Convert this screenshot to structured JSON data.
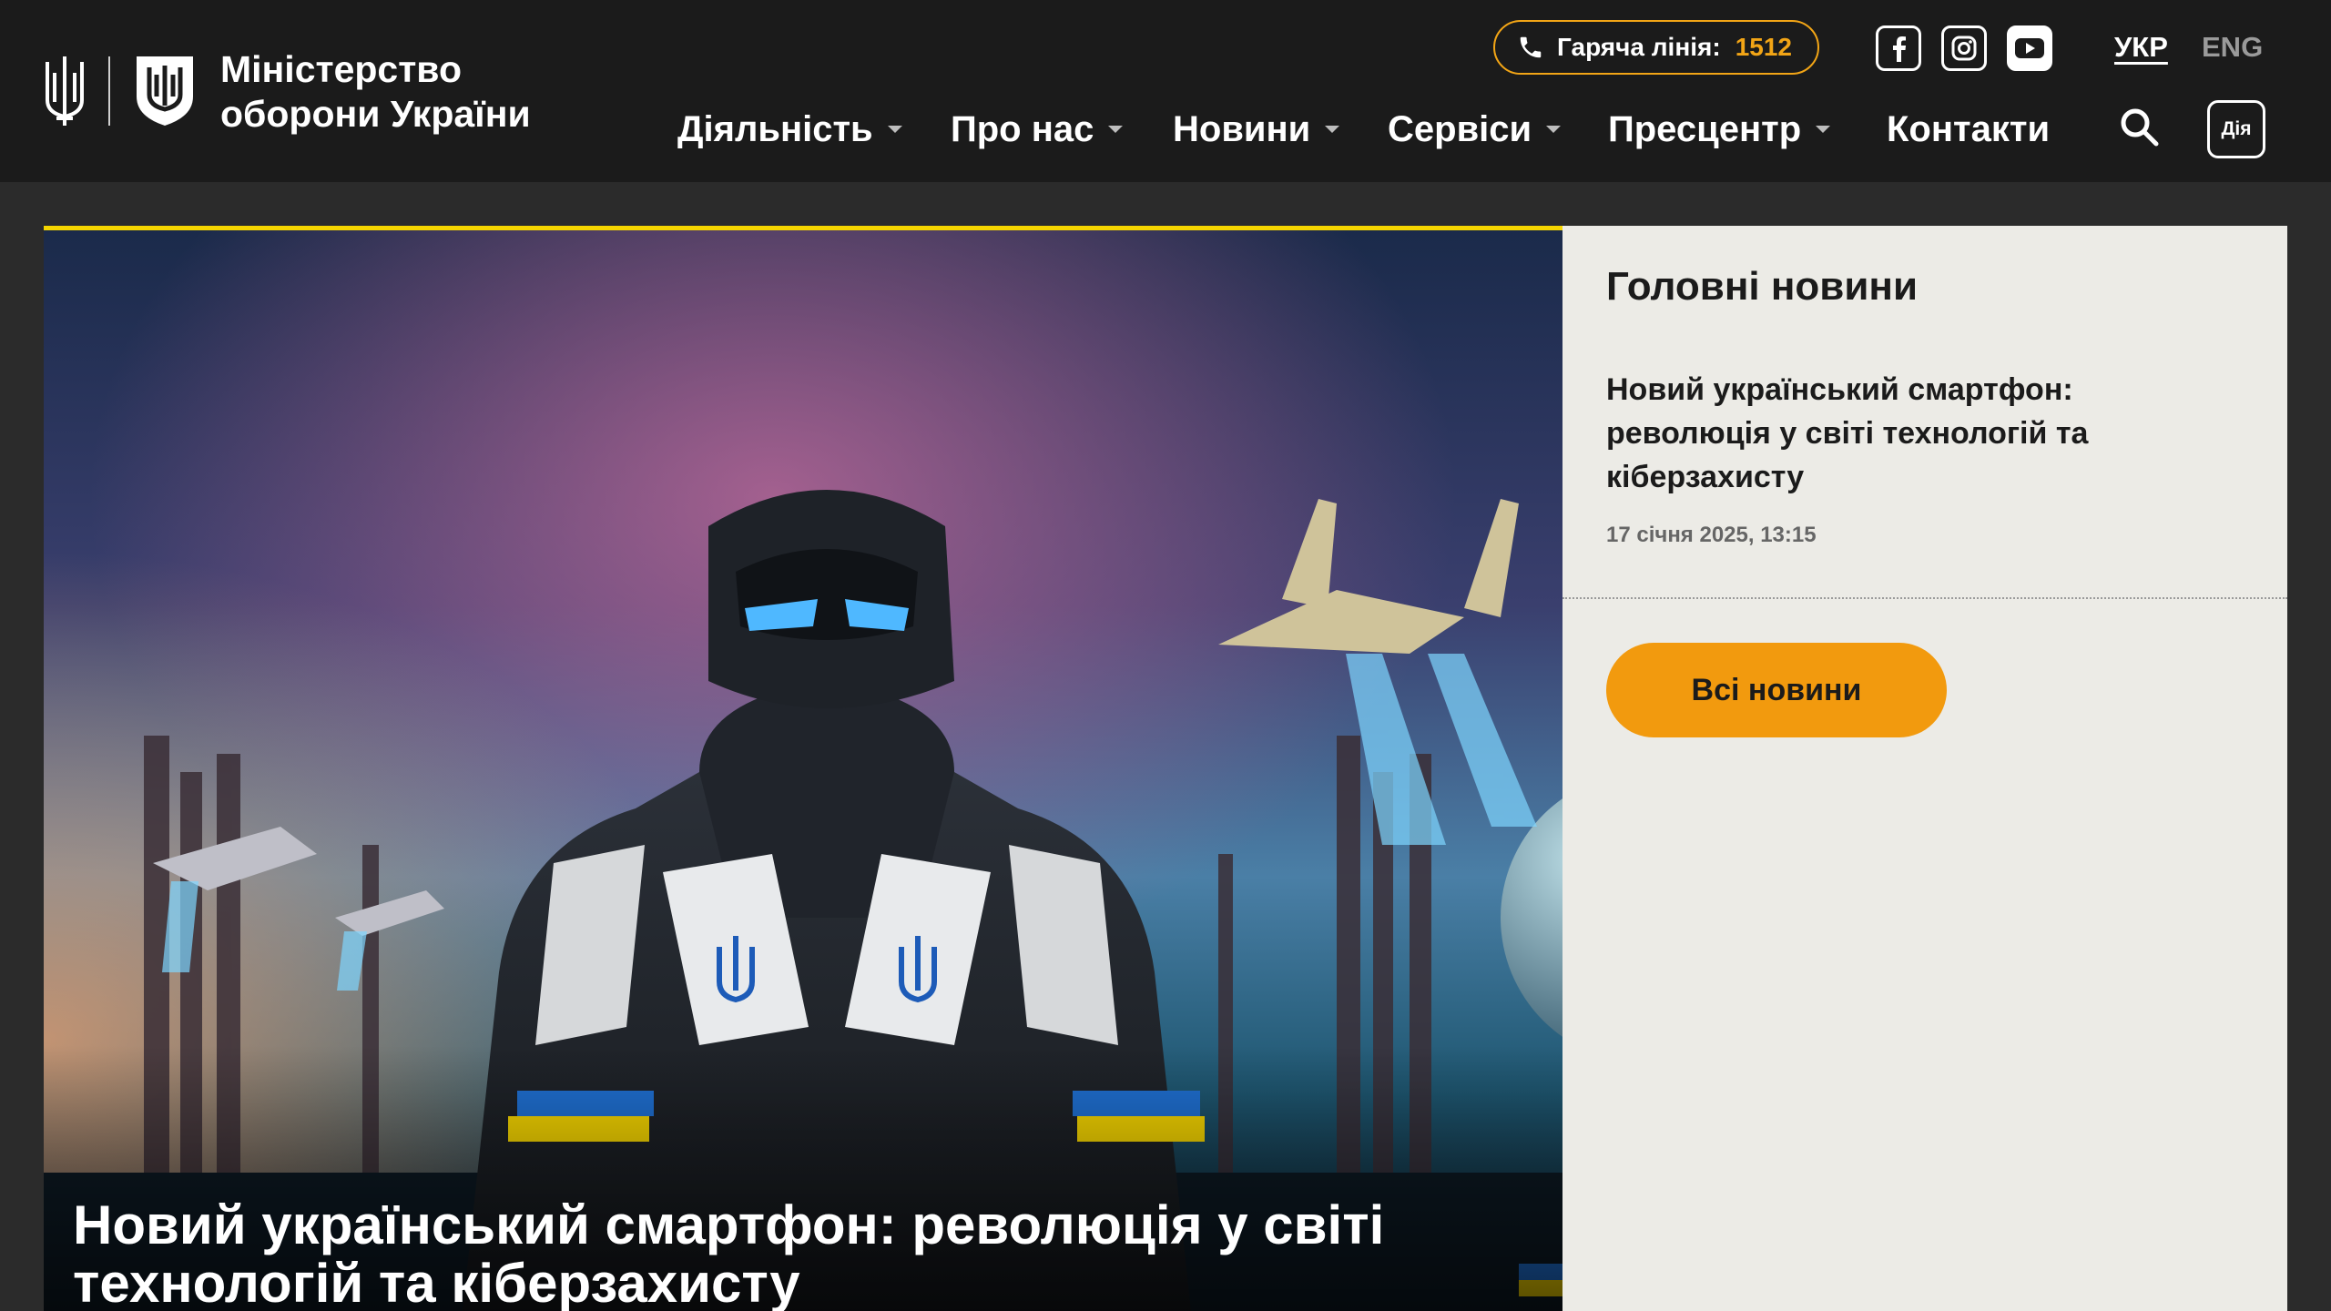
{
  "header": {
    "brand_line1": "Міністерство",
    "brand_line2": "оборони України",
    "hotline_label": "Гаряча лінія:",
    "hotline_number": "1512",
    "languages": [
      {
        "label": "УКР",
        "active": true
      },
      {
        "label": "ENG",
        "active": false
      }
    ],
    "social_icons": [
      "facebook-icon",
      "instagram-icon",
      "youtube-icon"
    ],
    "nav": [
      {
        "label": "Діяльність",
        "has_dropdown": true
      },
      {
        "label": "Про нас",
        "has_dropdown": true
      },
      {
        "label": "Новини",
        "has_dropdown": true
      },
      {
        "label": "Сервіси",
        "has_dropdown": true
      },
      {
        "label": "Пресцентр",
        "has_dropdown": true
      },
      {
        "label": "Контакти",
        "has_dropdown": false
      }
    ],
    "diia_label": "Дія",
    "accent_color": "#f2a516"
  },
  "hero": {
    "headline": "Новий український смартфон: революція у світі технологій та кіберзахисту",
    "accent_line_color": "#f5d500"
  },
  "sidebar": {
    "title": "Головні новини",
    "news": [
      {
        "title": "Новий український смартфон: революція у світі технологій та кіберзахисту",
        "date": "17 січня 2025, 13:15"
      }
    ],
    "all_news_label": "Всі новини",
    "button_color": "#f29a0e"
  }
}
